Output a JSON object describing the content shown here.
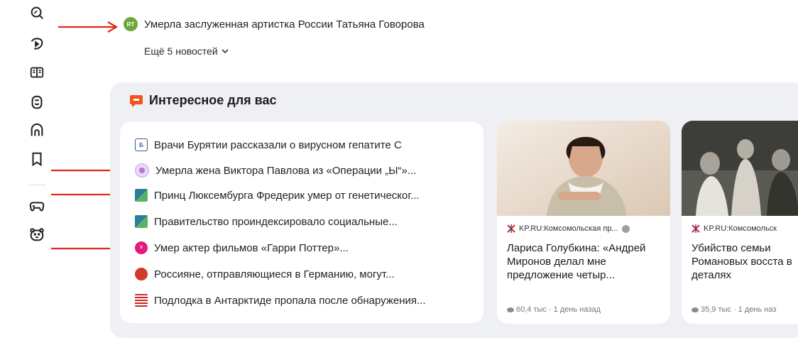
{
  "sidebar": {
    "icons": [
      "search-icon",
      "video-icon",
      "book-icon",
      "badge-icon",
      "brand-icon",
      "bookmark-icon",
      "gamepad-icon",
      "bear-icon"
    ]
  },
  "top_news": {
    "source_logo": "RT",
    "headline": "Умерла заслуженная артистка России Татьяна Говорова",
    "more_label": "Ещё 5 новостей"
  },
  "interesting": {
    "title": "Интересное для вас",
    "items": [
      {
        "icon": "b-logo",
        "text": "Врачи Бурятии рассказали о вирусном гепатите С"
      },
      {
        "icon": "circle-logo",
        "text": "Умерла жена Виктора Павлова из «Операции „Ы“»..."
      },
      {
        "icon": "flag-logo",
        "text": "Принц Люксембурга Фредерик умер от генетическог..."
      },
      {
        "icon": "flag-logo",
        "text": "Правительство проиндексировало социальные..."
      },
      {
        "icon": "voice-logo",
        "text": "Умер актер фильмов «Гарри Поттер»..."
      },
      {
        "icon": "red-logo",
        "text": "Россияне, отправляющиеся в Германию, могут..."
      },
      {
        "icon": "usa-flag-logo",
        "text": "Подлодка в Антарктиде пропала после обнаружения..."
      }
    ],
    "cards": [
      {
        "source": "KP.RU:Комсомольская пр...",
        "headline": "Лариса Голубкина: «Андрей Миронов делал мне предложение четыр...",
        "meta": "60,4 тыс · 1 день назад"
      },
      {
        "source": "KP.RU:Комсомольск",
        "headline": "Убийство семьи Романовых восста в деталях",
        "meta": "35,9 тыс · 1 день наз"
      }
    ]
  },
  "colors": {
    "accent_red": "#e0281f",
    "panel_bg": "#eef0f3",
    "card_bg": "#ffffff"
  }
}
